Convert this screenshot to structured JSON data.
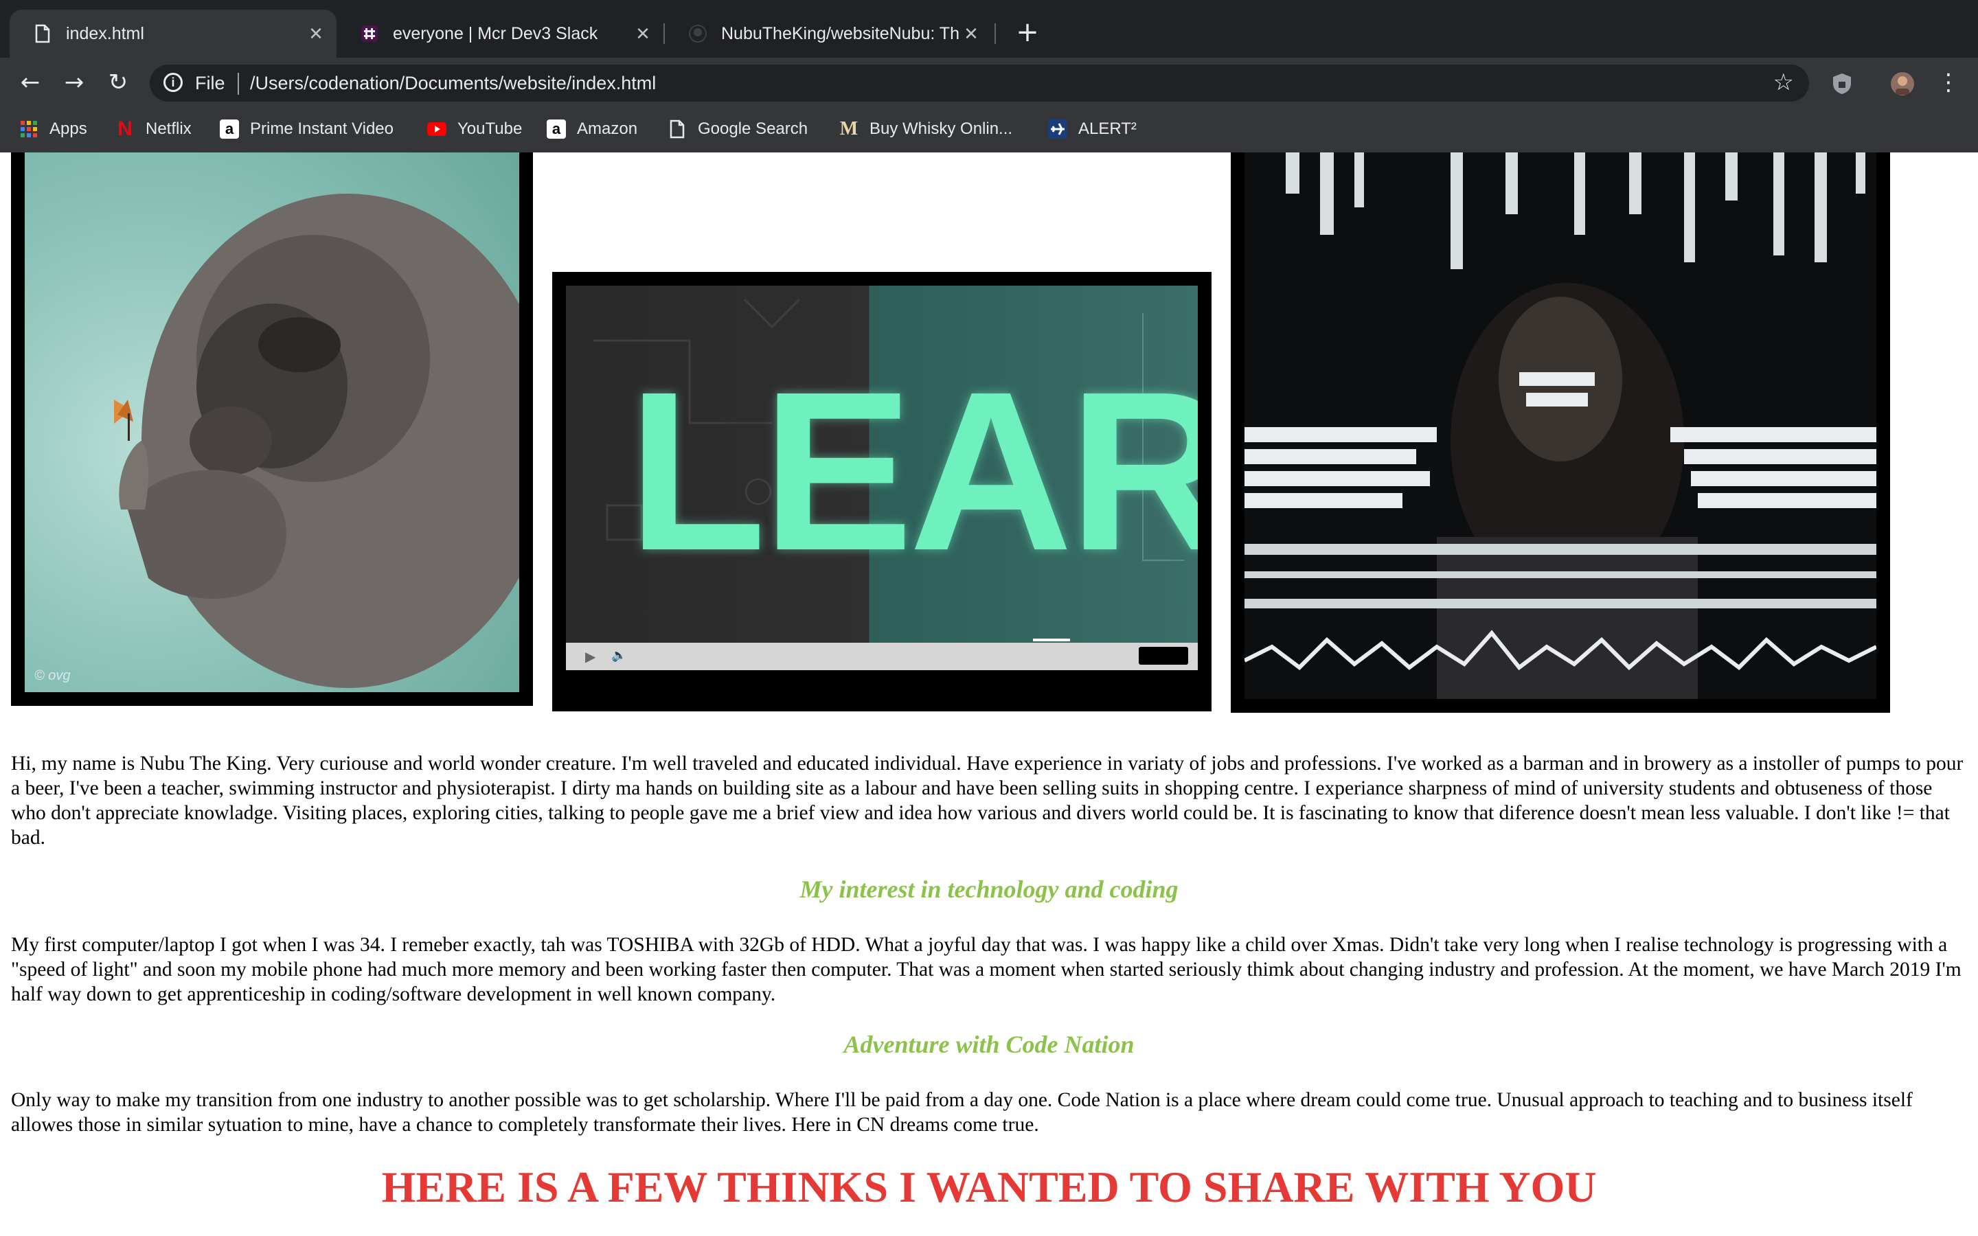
{
  "tabs": [
    {
      "title": "index.html",
      "icon": "file-icon",
      "active": true
    },
    {
      "title": "everyone | Mcr Dev3 Slack",
      "icon": "slack-icon",
      "active": false
    },
    {
      "title": "NubuTheKing/websiteNubu: Th",
      "icon": "github-icon",
      "active": false
    }
  ],
  "toolbar": {
    "scheme": "File",
    "url": "/Users/codenation/Documents/website/index.html"
  },
  "bookmarks": [
    {
      "label": "Apps",
      "icon": "apps-grid-icon"
    },
    {
      "label": "Netflix",
      "icon": "netflix-icon",
      "glyph": "N"
    },
    {
      "label": "Prime Instant Video",
      "icon": "amazon-icon",
      "glyph": "a"
    },
    {
      "label": "YouTube",
      "icon": "youtube-icon"
    },
    {
      "label": "Amazon",
      "icon": "amazon-icon",
      "glyph": "a"
    },
    {
      "label": "Google Search",
      "icon": "page-icon"
    },
    {
      "label": "Buy Whisky Onlin...",
      "icon": "whisky-icon",
      "glyph": "M"
    },
    {
      "label": "ALERT²",
      "icon": "plane-icon"
    }
  ],
  "gallery": {
    "learn_banner": "LEARN",
    "watermark": "© ovg"
  },
  "content": {
    "intro": "Hi, my name is Nubu The King. Very curiouse and world wonder creature. I'm well traveled and educated individual. Have experience in variaty of jobs and professions. I've worked as a barman and in browery as a instoller of pumps to pour a beer, I've been a teacher, swimming instructor and physioterapist. I dirty ma hands on building site as a labour and have been selling suits in shopping centre. I experiance sharpness of mind of university students and obtuseness of those who don't appreciate knowladge. Visiting places, exploring cities, talking to people gave me a brief view and idea how various and divers world could be. It is fascinating to know that diference doesn't mean less valuable. I don't like != that bad.",
    "heading1": "My interest in technology and coding",
    "para1": "My first computer/laptop I got when I was 34. I remeber exactly, tah was TOSHIBA with 32Gb of HDD. What a joyful day that was. I was happy like a child over Xmas. Didn't take very long when I realise technology is progressing with a \"speed of light\" and soon my mobile phone had much more memory and been working faster then computer. That was a moment when started seriously thimk about changing industry and profession. At the moment, we have March 2019 I'm half way down to get apprenticeship in coding/software development in well known company.",
    "heading2": "Adventure with Code Nation",
    "para2": "Only way to make my transition from one industry to another possible was to get scholarship. Where I'll be paid from a day one. Code Nation is a place where dream could come true. Unusual approach to teaching and to business itself allowes those in similar sytuation to mine, have a chance to completely transformate their lives. Here in CN dreams come true.",
    "big_heading": "HERE IS A FEW THINKS I WANTED TO SHARE WITH YOU"
  },
  "colors": {
    "chrome_dark": "#202124",
    "chrome_toolbar": "#35363a",
    "heading_green": "#8bc34a",
    "heading_red": "#e53935"
  }
}
